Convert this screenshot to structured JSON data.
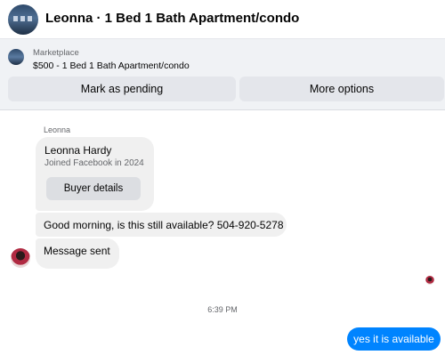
{
  "header": {
    "title": "Leonna · 1 Bed 1 Bath Apartment/condo"
  },
  "marketplace": {
    "label": "Marketplace",
    "listing": "$500 - 1 Bed 1 Bath Apartment/condo",
    "mark_pending_label": "Mark as pending",
    "more_options_label": "More options"
  },
  "conversation": {
    "clipped_text": "",
    "sender_label": "Leonna",
    "profile": {
      "name": "Leonna Hardy",
      "joined": "Joined Facebook in 2024",
      "buyer_details_label": "Buyer details"
    },
    "incoming": [
      {
        "text": "Good morning, is this still available? 504-920-5278"
      },
      {
        "text": "Message sent"
      }
    ],
    "timestamp": "6:39 PM",
    "outgoing": [
      {
        "text": "yes it is available"
      }
    ],
    "status_text": ""
  },
  "colors": {
    "accent": "#0084ff",
    "incoming_bubble": "#f0f0f0",
    "banner_bg": "#f0f2f5",
    "button_bg": "#e4e6eb"
  }
}
